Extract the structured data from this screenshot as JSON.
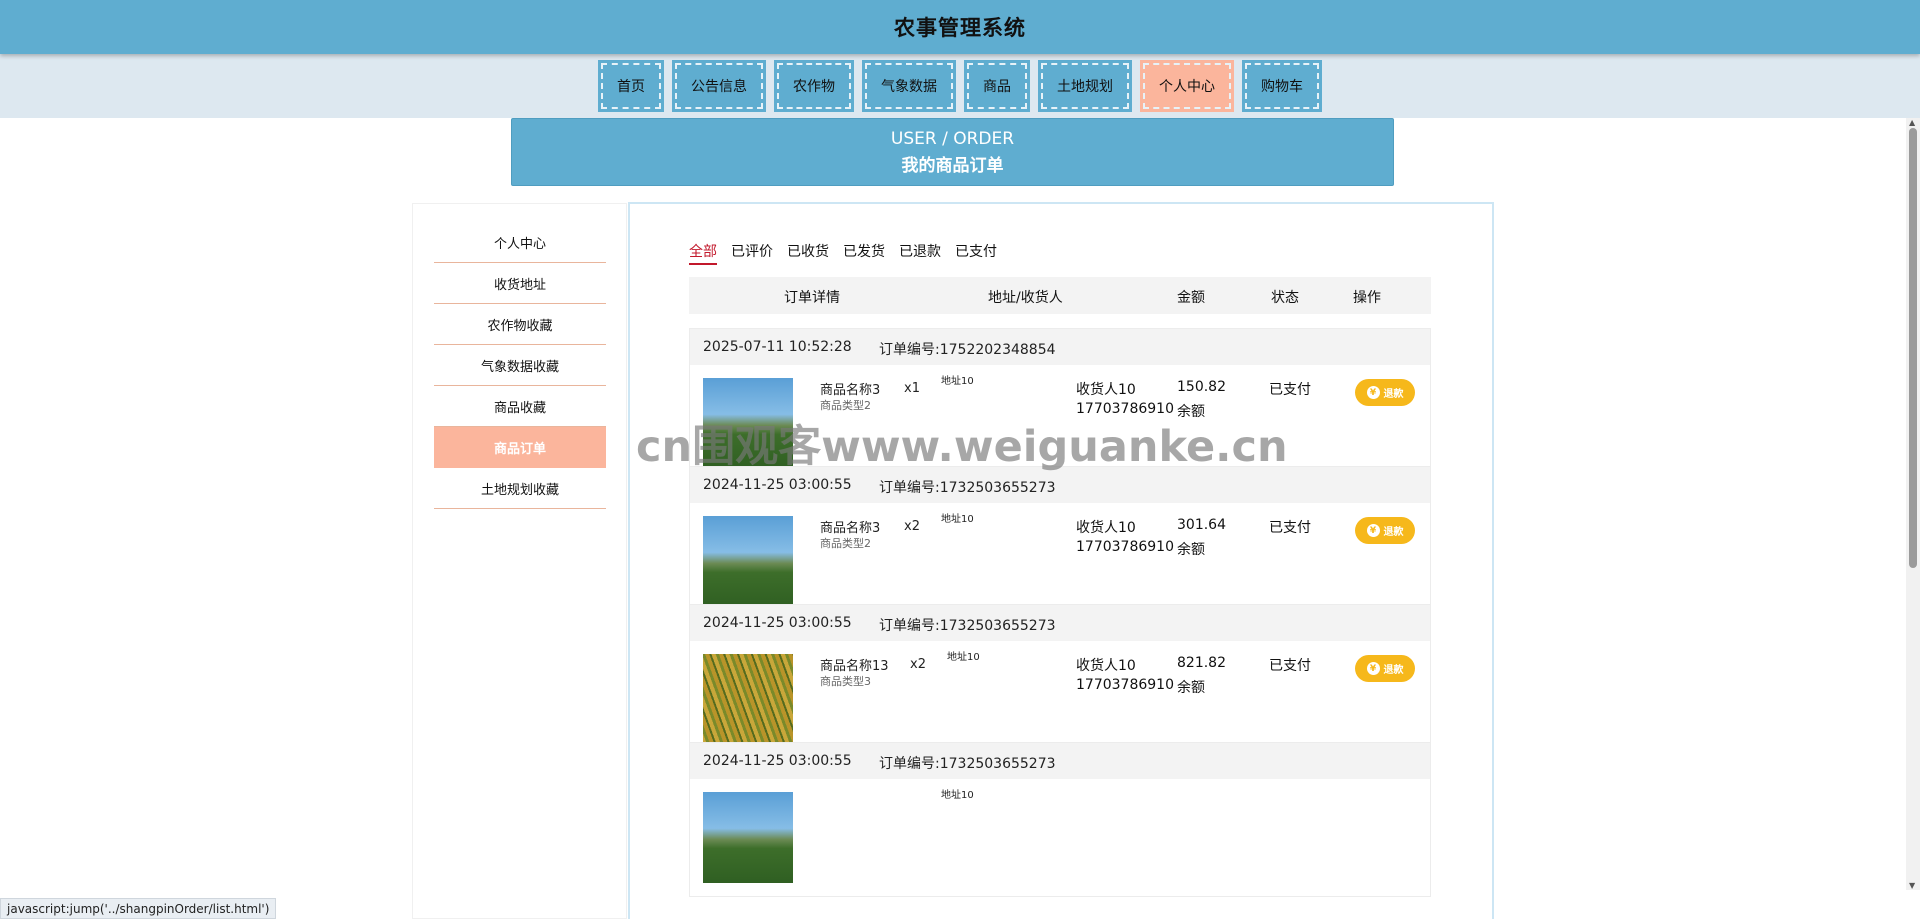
{
  "header": {
    "title": "农事管理系统"
  },
  "nav": {
    "items": [
      {
        "label": "首页",
        "active": false
      },
      {
        "label": "公告信息",
        "active": false
      },
      {
        "label": "农作物",
        "active": false
      },
      {
        "label": "气象数据",
        "active": false
      },
      {
        "label": "商品",
        "active": false
      },
      {
        "label": "土地规划",
        "active": false
      },
      {
        "label": "个人中心",
        "active": true
      },
      {
        "label": "购物车",
        "active": false
      }
    ]
  },
  "banner": {
    "en": "USER / ORDER",
    "cn": "我的商品订单"
  },
  "sidebar": {
    "items": [
      {
        "label": "个人中心",
        "active": false
      },
      {
        "label": "收货地址",
        "active": false
      },
      {
        "label": "农作物收藏",
        "active": false
      },
      {
        "label": "气象数据收藏",
        "active": false
      },
      {
        "label": "商品收藏",
        "active": false
      },
      {
        "label": "商品订单",
        "active": true
      },
      {
        "label": "土地规划收藏",
        "active": false
      }
    ]
  },
  "tabs": [
    {
      "label": "全部",
      "active": true
    },
    {
      "label": "已评价",
      "active": false
    },
    {
      "label": "已收货",
      "active": false
    },
    {
      "label": "已发货",
      "active": false
    },
    {
      "label": "已退款",
      "active": false
    },
    {
      "label": "已支付",
      "active": false
    }
  ],
  "table": {
    "headers": {
      "detail": "订单详情",
      "address": "地址/收货人",
      "amount": "金额",
      "status": "状态",
      "action": "操作"
    }
  },
  "orders": [
    {
      "date": "2025-07-11 10:52:28",
      "order_no": "订单编号:1752202348854",
      "product_name": "商品名称3",
      "product_type": "商品类型2",
      "qty": "x1",
      "address": "地址10",
      "receiver": "收货人10",
      "phone": "17703786910",
      "amount": "150.82",
      "pay_method": "余额",
      "status": "已支付",
      "action": "退款",
      "image": "field"
    },
    {
      "date": "2024-11-25 03:00:55",
      "order_no": "订单编号:1732503655273",
      "product_name": "商品名称3",
      "product_type": "商品类型2",
      "qty": "x2",
      "address": "地址10",
      "receiver": "收货人10",
      "phone": "17703786910",
      "amount": "301.64",
      "pay_method": "余额",
      "status": "已支付",
      "action": "退款",
      "image": "field"
    },
    {
      "date": "2024-11-25 03:00:55",
      "order_no": "订单编号:1732503655273",
      "product_name": "商品名称13",
      "product_type": "商品类型3",
      "qty": "x2",
      "address": "地址10",
      "receiver": "收货人10",
      "phone": "17703786910",
      "amount": "821.82",
      "pay_method": "余额",
      "status": "已支付",
      "action": "退款",
      "image": "rice"
    },
    {
      "date": "2024-11-25 03:00:55",
      "order_no": "订单编号:1732503655273",
      "product_name": "",
      "product_type": "",
      "qty": "",
      "address": "地址10",
      "receiver": "",
      "phone": "",
      "amount": "",
      "pay_method": "",
      "status": "",
      "action": "",
      "image": "field"
    }
  ],
  "watermark": "cn围观客www.weiguanke.cn",
  "statusbar": {
    "text": "javascript:jump('../shangpinOrder/list.html')"
  },
  "colors": {
    "primary": "#5fadd0",
    "accent": "#fbb59c",
    "refund": "#f6b81b",
    "tab_active": "#c2182b"
  }
}
